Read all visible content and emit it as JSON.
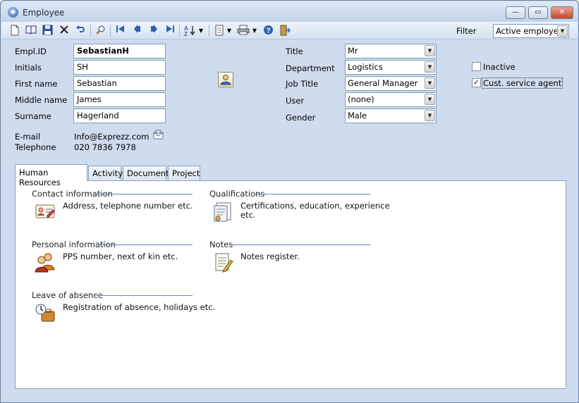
{
  "window": {
    "title": "Employee"
  },
  "titlebar_buttons": {
    "minimize": "—",
    "maximize": "▭",
    "close": "✕"
  },
  "toolbar": {
    "filter_label": "Filter",
    "filter_value": "Active employees"
  },
  "form": {
    "empl_id": {
      "label": "Empl.ID",
      "value": "SebastianH"
    },
    "initials": {
      "label": "Initials",
      "value": "SH"
    },
    "first_name": {
      "label": "First name",
      "value": "Sebastian"
    },
    "middle_name": {
      "label": "Middle name",
      "value": "James"
    },
    "surname": {
      "label": "Surname",
      "value": "Hagerland"
    },
    "email": {
      "label": "E-mail",
      "value": "Info@Exprezz.com"
    },
    "telephone": {
      "label": "Telephone",
      "value": "020 7836 7978"
    },
    "title": {
      "label": "Title",
      "value": "Mr"
    },
    "department": {
      "label": "Department",
      "value": "Logistics"
    },
    "job_title": {
      "label": "Job Title",
      "value": "General Manager"
    },
    "user": {
      "label": "User",
      "value": "(none)"
    },
    "gender": {
      "label": "Gender",
      "value": "Male"
    },
    "inactive": {
      "label": "Inactive",
      "checked": false
    },
    "cust_service_agent": {
      "label": "Cust. service agent",
      "checked": true
    }
  },
  "tabs": [
    {
      "label": "Human Resources",
      "active": true
    },
    {
      "label": "Activity",
      "active": false
    },
    {
      "label": "Document",
      "active": false
    },
    {
      "label": "Project",
      "active": false
    }
  ],
  "sections": {
    "contact": {
      "title": "Contact information",
      "desc": "Address, telephone number etc."
    },
    "qualifications": {
      "title": "Qualifications",
      "desc_line1": "Certifications, education, experience",
      "desc_line2": "etc."
    },
    "personal": {
      "title": "Personal information",
      "desc": "PPS number, next of kin etc."
    },
    "notes": {
      "title": "Notes",
      "desc": "Notes register."
    },
    "leave": {
      "title": "Leave of absence",
      "desc": "Registration of absence, holidays etc."
    }
  },
  "colors": {
    "window_bg": "#cfdcee",
    "accent_line": "#5f86c0",
    "field_border": "#7f9db9"
  }
}
